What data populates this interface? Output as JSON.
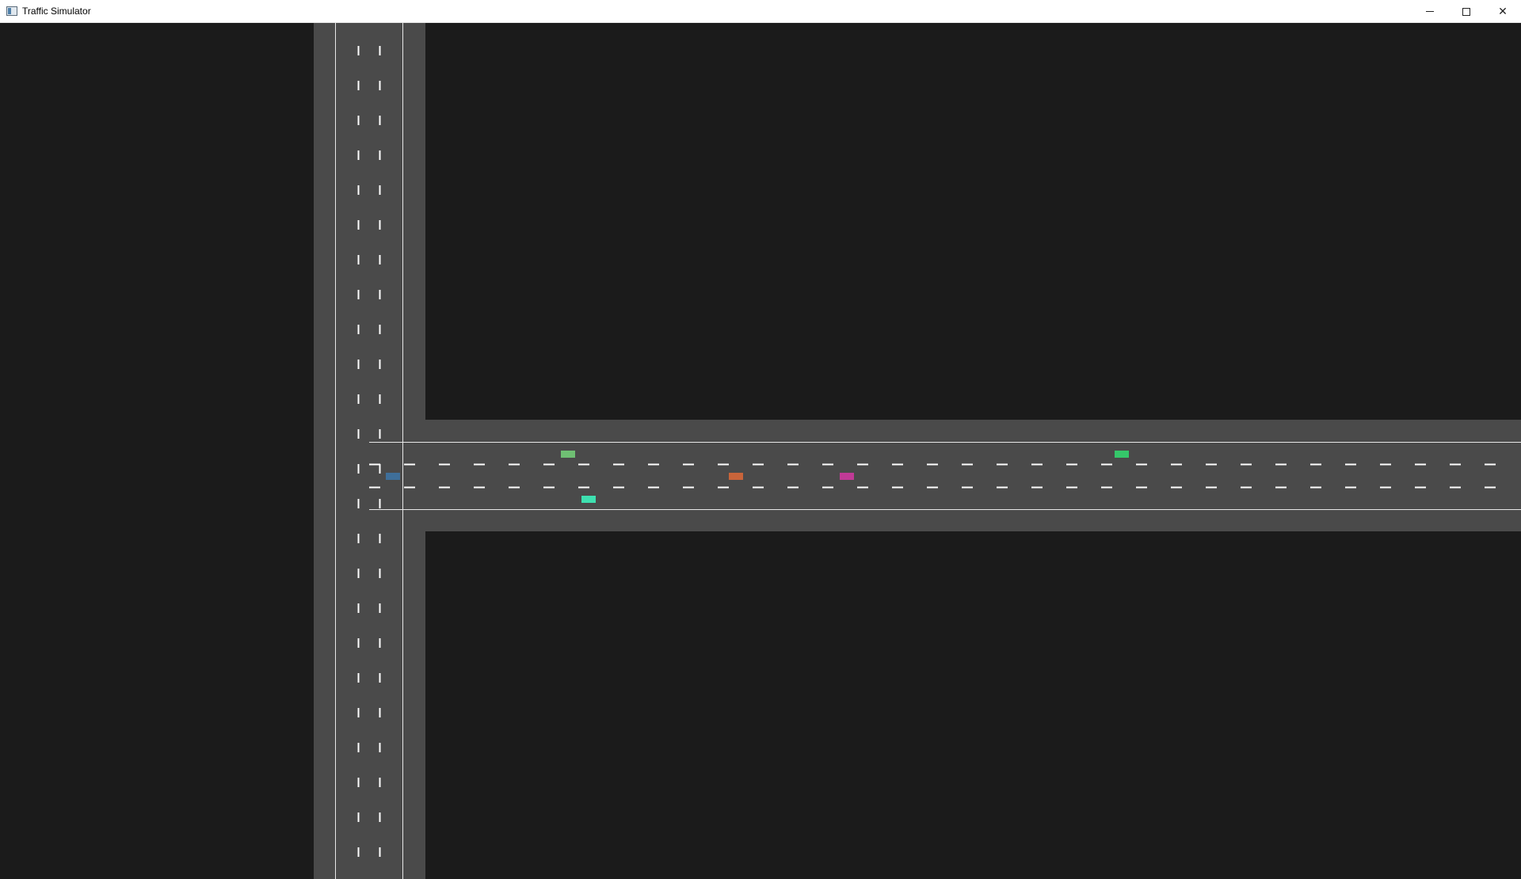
{
  "window": {
    "title": "Traffic Simulator",
    "app_icon": "app-window-icon",
    "controls": {
      "minimize_icon": "minimize-icon",
      "maximize_icon": "maximize-icon",
      "close_icon": "close-icon"
    }
  },
  "simulation": {
    "colors": {
      "background": "#1b1b1b",
      "road_surface": "#4a4a4a",
      "lane_marking": "#ffffff",
      "boundary_line": "#e8e8e8"
    },
    "vehicles": [
      {
        "name": "vehicle-green-light",
        "color": "#6fbf73"
      },
      {
        "name": "vehicle-teal",
        "color": "#3ee0b0"
      },
      {
        "name": "vehicle-blue",
        "color": "#3f6f9a"
      },
      {
        "name": "vehicle-orange",
        "color": "#c8643a"
      },
      {
        "name": "vehicle-magenta",
        "color": "#c03a96"
      },
      {
        "name": "vehicle-green",
        "color": "#35c76a"
      }
    ]
  }
}
